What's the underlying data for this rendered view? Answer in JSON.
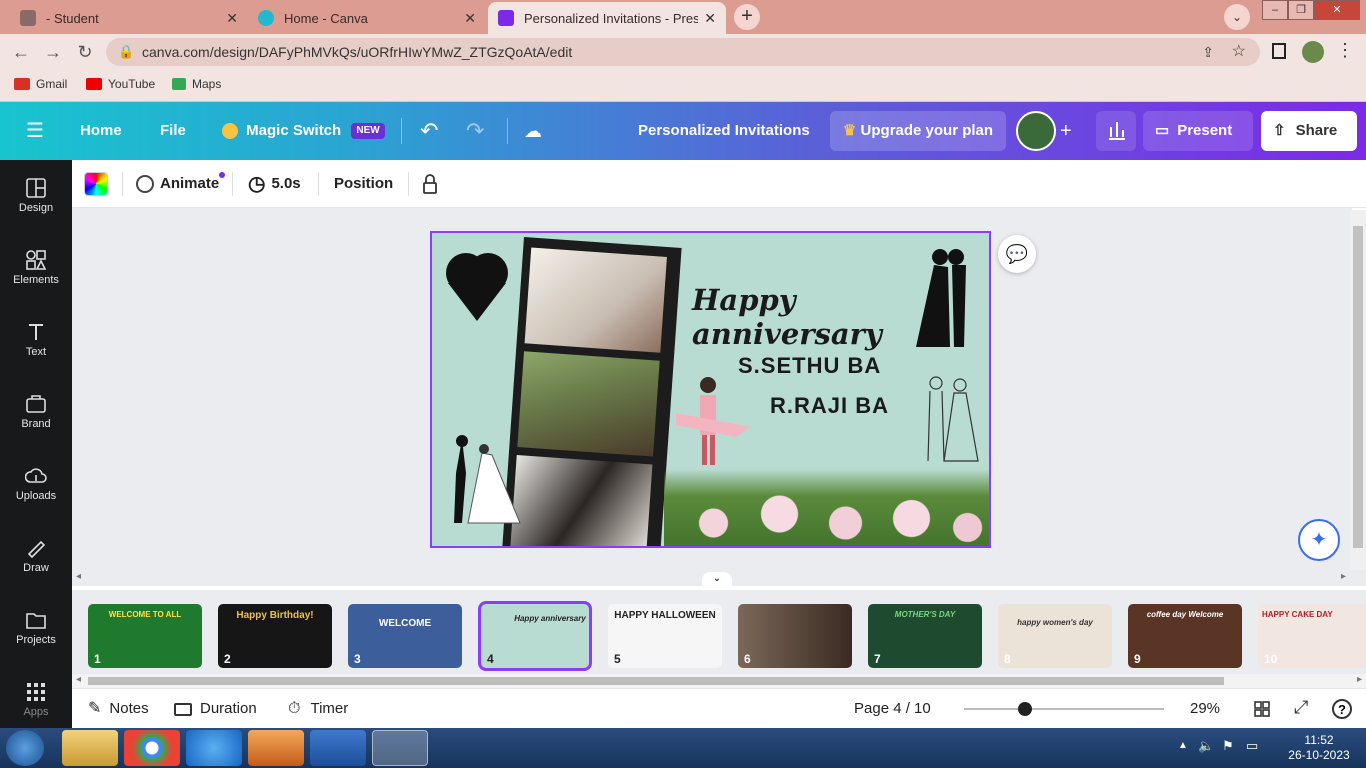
{
  "browser": {
    "tabs": [
      {
        "title": "- Student",
        "active": false
      },
      {
        "title": "Home - Canva",
        "active": false
      },
      {
        "title": "Personalized Invitations - Present",
        "active": true
      }
    ],
    "url": "canva.com/design/DAFyPhMVkQs/uORfrHIwYMwZ_ZTGzQoAtA/edit",
    "bookmarks": [
      "Gmail",
      "YouTube",
      "Maps"
    ]
  },
  "header": {
    "home": "Home",
    "file": "File",
    "magic_switch": "Magic Switch",
    "new_badge": "NEW",
    "doc_title": "Personalized Invitations",
    "upgrade": "Upgrade your plan",
    "present": "Present",
    "share": "Share"
  },
  "sidebar": [
    {
      "label": "Design",
      "icon": "layout-icon"
    },
    {
      "label": "Elements",
      "icon": "shapes-icon"
    },
    {
      "label": "Text",
      "icon": "text-icon"
    },
    {
      "label": "Brand",
      "icon": "brand-icon"
    },
    {
      "label": "Uploads",
      "icon": "cloud-upload-icon"
    },
    {
      "label": "Draw",
      "icon": "pen-icon"
    },
    {
      "label": "Projects",
      "icon": "folder-icon"
    },
    {
      "label": "Apps",
      "icon": "grid-icon"
    }
  ],
  "toolbar": {
    "animate": "Animate",
    "duration": "5.0s",
    "position": "Position"
  },
  "design": {
    "title": "Happy anniversary",
    "name1": "S.SETHU BA",
    "name2": "R.RAJI BA"
  },
  "thumbnails": [
    {
      "num": "1",
      "text": "WELCOME TO ALL",
      "bg": "#1f7a2e"
    },
    {
      "num": "2",
      "text": "Happy Birthday!",
      "bg": "#161616"
    },
    {
      "num": "3",
      "text": "WELCOME",
      "bg": "#3c5e9a"
    },
    {
      "num": "4",
      "text": "Happy anniversary",
      "bg": "#b9dcd2"
    },
    {
      "num": "5",
      "text": "HAPPY HALLOWEEN",
      "bg": "#f6f6f6"
    },
    {
      "num": "6",
      "text": "",
      "bg": "#4a3a32"
    },
    {
      "num": "7",
      "text": "MOTHER'S DAY",
      "bg": "#1e4a30"
    },
    {
      "num": "8",
      "text": "happy women's day",
      "bg": "#ece3d8"
    },
    {
      "num": "9",
      "text": "coffee day Welcome",
      "bg": "#5a3424"
    },
    {
      "num": "10",
      "text": "HAPPY CAKE DAY",
      "bg": "#f2e6e0"
    }
  ],
  "bottombar": {
    "notes": "Notes",
    "duration": "Duration",
    "timer": "Timer",
    "page": "Page 4 / 10",
    "zoom": "29%",
    "zoom_level": 0.29
  },
  "taskbar": {
    "time": "11:52",
    "date": "26-10-2023"
  }
}
